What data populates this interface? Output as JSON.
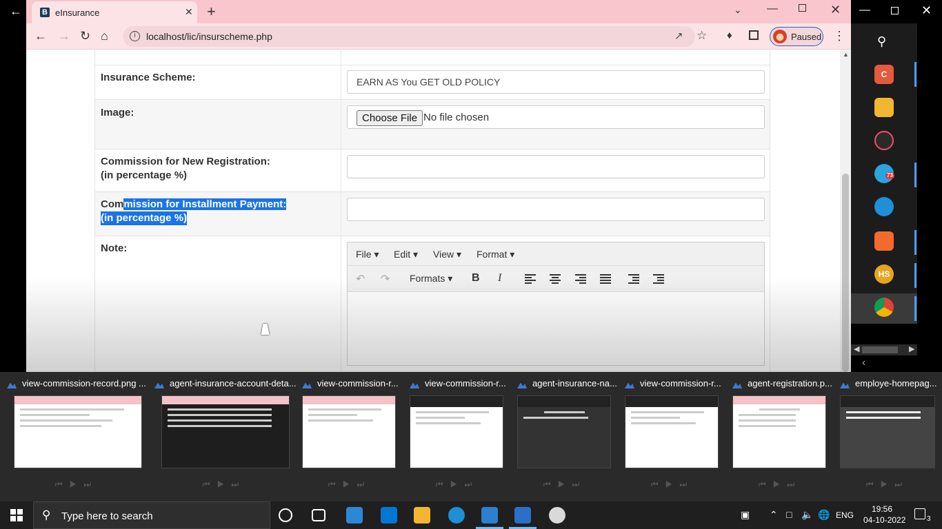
{
  "browser": {
    "tab_title": "eInsurance",
    "tab_favicon": "B",
    "url": "localhost/lic/insurscheme.php",
    "profile_label": "Paused"
  },
  "form": {
    "scheme_label": "Insurance Scheme:",
    "scheme_value": "EARN AS You GET OLD POLICY",
    "image_label": "Image:",
    "choose_file": "Choose File",
    "no_file": "No file chosen",
    "new_reg_label_1": "Commission for New Registration:",
    "new_reg_label_2": "(in percentage %)",
    "new_reg_value": "",
    "install_label_1a": "Com",
    "install_label_1b": "mission for Installment Payment:",
    "install_label_2": "(in percentage %)",
    "install_value": "",
    "note_label": "Note:"
  },
  "editor": {
    "menus": [
      "File",
      "Edit",
      "View",
      "Format"
    ],
    "formats_label": "Formats",
    "bold": "B",
    "italic": "I"
  },
  "dock": {
    "badge": "73",
    "hs_label": "HS"
  },
  "thumbnails": [
    {
      "title": "view-commission-record.png ..."
    },
    {
      "title": "agent-insurance-account-deta..."
    },
    {
      "title": "view-commission-r..."
    },
    {
      "title": "view-commission-r..."
    },
    {
      "title": "agent-insurance-na..."
    },
    {
      "title": "view-commission-r..."
    },
    {
      "title": "agent-registration.p..."
    },
    {
      "title": "employe-homepag..."
    }
  ],
  "taskbar": {
    "search_placeholder": "Type here to search",
    "language": "ENG",
    "time": "19:56",
    "date": "04-10-2022",
    "notification_count": "3"
  },
  "colors": {
    "chrome_pink": "#f8c6cc",
    "selection": "#1a73e8",
    "accent": "#76b9ed"
  }
}
